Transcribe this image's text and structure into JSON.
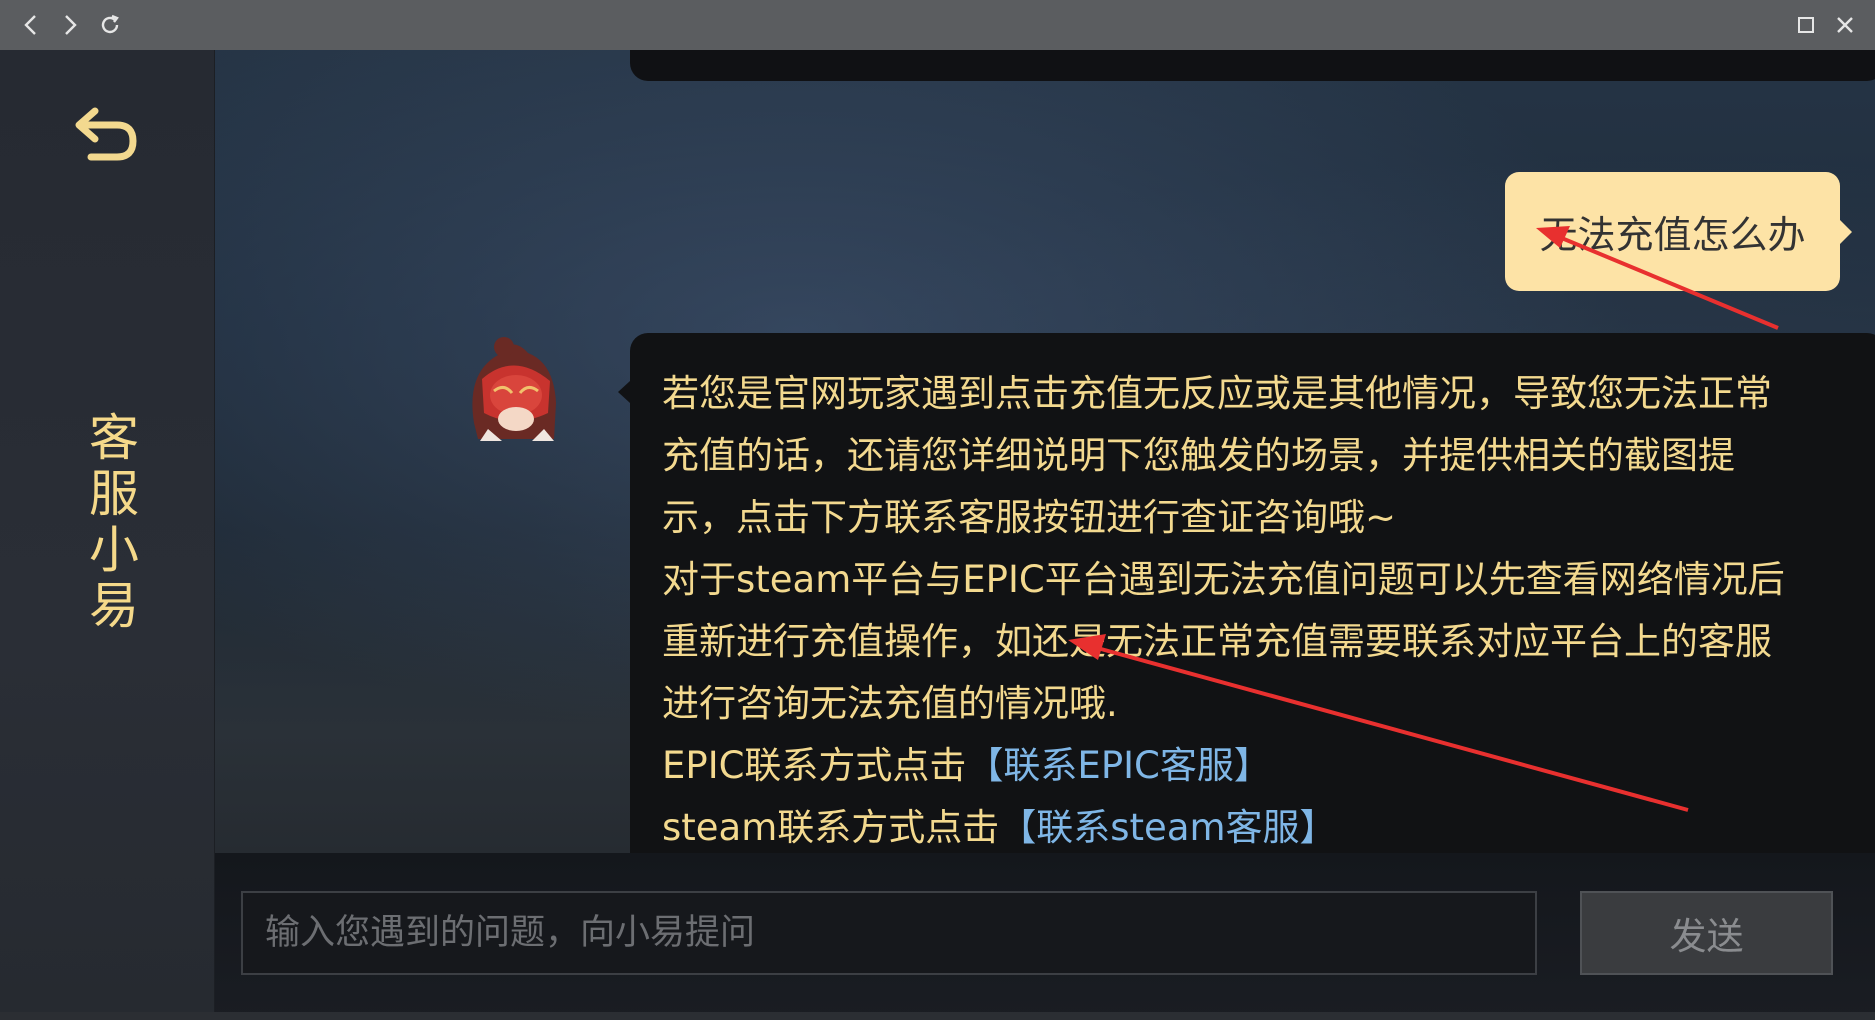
{
  "browser": {
    "back_icon": "chevron-left-icon",
    "forward_icon": "chevron-right-icon",
    "reload_icon": "reload-icon",
    "maximize_icon": "maximize-icon",
    "close_icon": "close-icon"
  },
  "sidebar": {
    "back_icon": "return-arrow-icon",
    "title_chars": [
      "客",
      "服",
      "小",
      "易"
    ]
  },
  "chat": {
    "user_message": "无法充值怎么办",
    "bot_message": {
      "lines": [
        "若您是官网玩家遇到点击充值无反应或是其他情况，导致您无法正常",
        "充值的话，还请您详细说明下您触发的场景，并提供相关的截图提",
        "示，点击下方联系客服按钮进行查证咨询哦~",
        "对于steam平台与EPIC平台遇到无法充值问题可以先查看网络情况后",
        "重新进行充值操作，如还是无法正常充值需要联系对应平台上的客服",
        "进行咨询无法充值的情况哦."
      ],
      "epic_prefix": "EPIC联系方式点击",
      "epic_link": "【联系EPIC客服】",
      "steam_prefix": "steam联系方式点击",
      "steam_link": "【联系steam客服】"
    }
  },
  "input": {
    "placeholder": "输入您遇到的问题，向小易提问",
    "value": "",
    "send_label": "发送"
  },
  "colors": {
    "accent_gold": "#f3d98f",
    "link_blue": "#7fb6e6",
    "user_bubble": "#fde3a6",
    "annotation_red": "#e8302f"
  }
}
